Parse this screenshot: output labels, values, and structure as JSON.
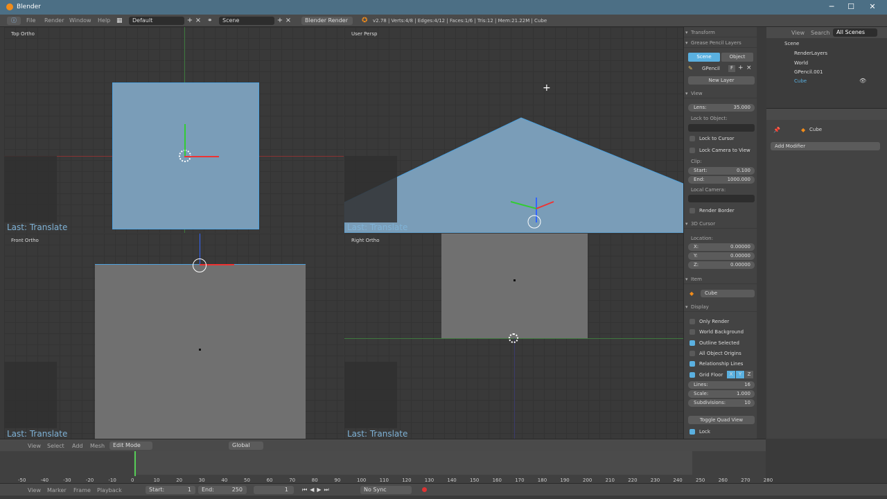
{
  "window": {
    "title": "Blender",
    "minimize": "─",
    "maximize": "☐",
    "close": "✕"
  },
  "infoheader": {
    "menus": [
      "File",
      "Render",
      "Window",
      "Help"
    ],
    "layout": "Default",
    "scene": "Scene",
    "engine": "Blender Render",
    "stats": "v2.78 | Verts:4/8 | Edges:4/12 | Faces:1/6 | Tris:12 | Mem:21.22M | Cube"
  },
  "viewports": {
    "top_left": {
      "label": "Top Ortho",
      "last": "Last: Translate"
    },
    "top_right": {
      "label": "User Persp",
      "last": "Last: Translate"
    },
    "bottom_left": {
      "label": "Front Ortho",
      "last": "Last: Translate"
    },
    "bottom_right": {
      "label": "Right Ortho",
      "last": "Last: Translate"
    }
  },
  "npanel": {
    "transform": "Transform",
    "grease_pencil": "Grease Pencil Layers",
    "tab_scene": "Scene",
    "tab_object": "Object",
    "gpencil_name": "GPencil",
    "gpencil_f": "F",
    "new_layer": "New Layer",
    "view": "View",
    "lens_label": "Lens:",
    "lens_value": "35.000",
    "lock_to_object": "Lock to Object:",
    "lock_to_cursor": "Lock to Cursor",
    "lock_camera": "Lock Camera to View",
    "clip": "Clip:",
    "clip_start_label": "Start:",
    "clip_start": "0.100",
    "clip_end_label": "End:",
    "clip_end": "1000.000",
    "local_camera": "Local Camera:",
    "render_border": "Render Border",
    "cursor3d": "3D Cursor",
    "location": "Location:",
    "x_label": "X:",
    "x_val": "0.00000",
    "y_label": "Y:",
    "y_val": "0.00000",
    "z_label": "Z:",
    "z_val": "0.00000",
    "item": "Item",
    "item_name": "Cube",
    "display": "Display",
    "only_render": "Only Render",
    "world_background": "World Background",
    "outline_selected": "Outline Selected",
    "all_object_origins": "All Object Origins",
    "relationship_lines": "Relationship Lines",
    "grid_floor": "Grid Floor",
    "gx": "X",
    "gy": "Y",
    "gz": "Z",
    "lines_label": "Lines:",
    "lines": "16",
    "scale_label": "Scale:",
    "scale": "1.000",
    "subdivisions_label": "Subdivisions:",
    "subdivisions": "10",
    "toggle_quad": "Toggle Quad View",
    "lock": "Lock"
  },
  "outliner": {
    "view": "View",
    "search": "Search",
    "all_scenes": "All Scenes",
    "items": [
      "Scene",
      "RenderLayers",
      "World",
      "GPencil.001",
      "Cube"
    ]
  },
  "properties": {
    "object": "Cube",
    "add_modifier": "Add Modifier"
  },
  "view3d_header": {
    "menus": [
      "View",
      "Select",
      "Add",
      "Mesh"
    ],
    "mode": "Edit Mode",
    "orientation": "Global"
  },
  "timeline": {
    "ticks": [
      "-50",
      "-40",
      "-30",
      "-20",
      "-10",
      "0",
      "10",
      "20",
      "30",
      "40",
      "50",
      "60",
      "70",
      "80",
      "90",
      "100",
      "110",
      "120",
      "130",
      "140",
      "150",
      "160",
      "170",
      "180",
      "190",
      "200",
      "210",
      "220",
      "230",
      "240",
      "250",
      "260",
      "270",
      "280"
    ],
    "menus": [
      "View",
      "Marker",
      "Frame",
      "Playback"
    ],
    "start_label": "Start:",
    "start": "1",
    "end_label": "End:",
    "end": "250",
    "current": "1",
    "sync": "No Sync"
  }
}
